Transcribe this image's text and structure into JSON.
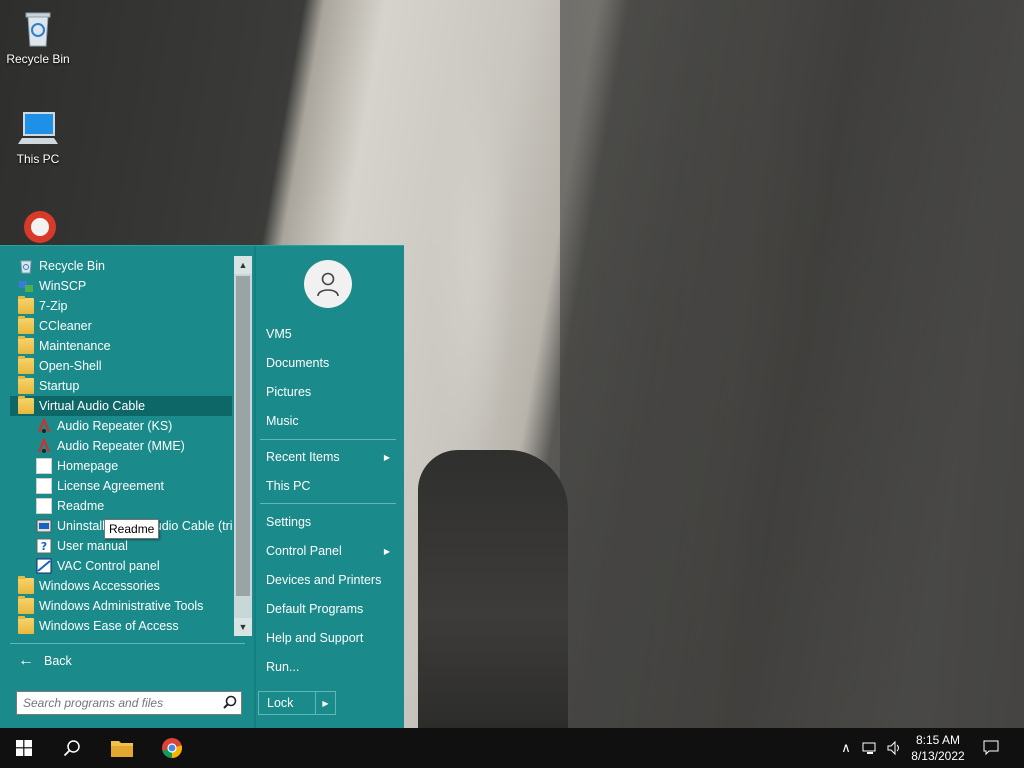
{
  "desktop": {
    "icons": [
      {
        "label": "Recycle Bin",
        "icon": "recycle-bin-icon"
      },
      {
        "label": "This PC",
        "icon": "computer-icon"
      },
      {
        "label": "",
        "icon": "ccleaner-icon"
      }
    ]
  },
  "start_menu": {
    "programs": [
      {
        "label": "Recycle Bin",
        "icon": "recycle-bin-icon"
      },
      {
        "label": "WinSCP",
        "icon": "winscp-icon"
      },
      {
        "label": "7-Zip",
        "icon": "folder-icon"
      },
      {
        "label": "CCleaner",
        "icon": "folder-icon"
      },
      {
        "label": "Maintenance",
        "icon": "folder-icon"
      },
      {
        "label": "Open-Shell",
        "icon": "folder-icon"
      },
      {
        "label": "Startup",
        "icon": "folder-icon"
      },
      {
        "label": "Virtual Audio Cable",
        "icon": "folder-icon",
        "highlighted": true
      },
      {
        "label": "Audio Repeater (KS)",
        "icon": "audio-repeater-icon",
        "sub": true
      },
      {
        "label": "Audio Repeater (MME)",
        "icon": "audio-repeater-icon",
        "sub": true
      },
      {
        "label": "Homepage",
        "icon": "document-icon",
        "sub": true
      },
      {
        "label": "License Agreement",
        "icon": "document-icon",
        "sub": true
      },
      {
        "label": "Readme",
        "icon": "document-icon",
        "sub": true
      },
      {
        "label": "Uninstall Virtual Audio Cable (trial)",
        "icon": "uninstall-icon",
        "sub": true
      },
      {
        "label": "User manual",
        "icon": "help-icon",
        "sub": true
      },
      {
        "label": "VAC Control panel",
        "icon": "control-panel-icon",
        "sub": true
      },
      {
        "label": "Windows Accessories",
        "icon": "folder-icon"
      },
      {
        "label": "Windows Administrative Tools",
        "icon": "folder-icon"
      },
      {
        "label": "Windows Ease of Access",
        "icon": "folder-icon"
      }
    ],
    "tooltip": "Readme",
    "back_label": "Back",
    "search_placeholder": "Search programs and files",
    "user_items": [
      {
        "label": "VM5"
      },
      {
        "label": "Documents"
      },
      {
        "label": "Pictures"
      },
      {
        "label": "Music"
      }
    ],
    "system_items": [
      {
        "label": "Recent Items",
        "submenu": true
      },
      {
        "label": "This PC"
      }
    ],
    "settings_items": [
      {
        "label": "Settings"
      },
      {
        "label": "Control Panel",
        "submenu": true
      },
      {
        "label": "Devices and Printers"
      },
      {
        "label": "Default Programs"
      },
      {
        "label": "Help and Support"
      },
      {
        "label": "Run..."
      }
    ],
    "lock_label": "Lock"
  },
  "taskbar": {
    "time": "8:15 AM",
    "date": "8/13/2022"
  },
  "colors": {
    "start_menu_bg": "#1a8a8a",
    "taskbar_bg": "#101010"
  }
}
